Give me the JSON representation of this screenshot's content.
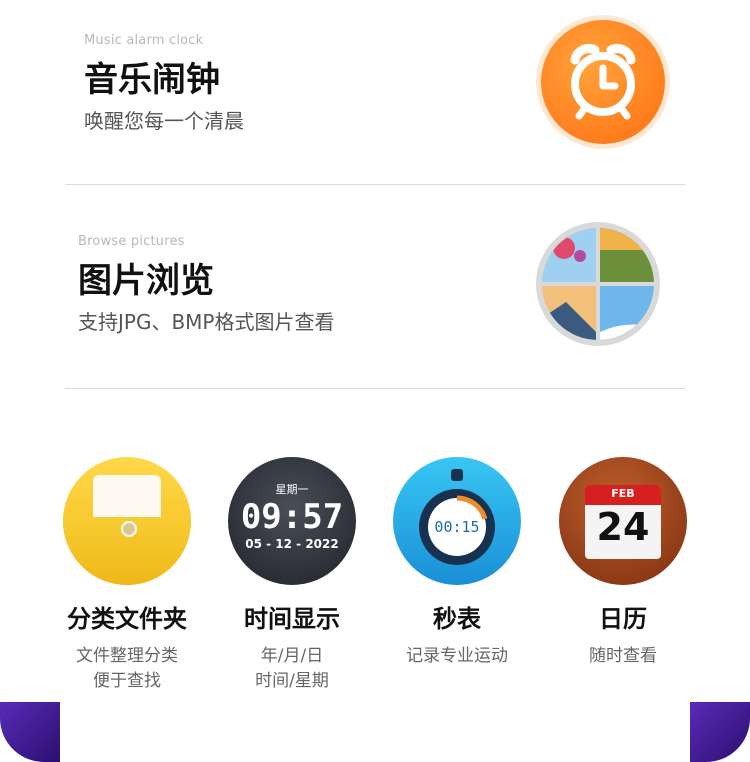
{
  "alarm": {
    "subtitle_en": "Music alarm clock",
    "title": "音乐闹钟",
    "desc": "唤醒您每一个清晨",
    "icon": "alarm-clock-icon",
    "color": "#ff7a1a"
  },
  "gallery": {
    "subtitle_en": "Browse pictures",
    "title": "图片浏览",
    "desc": "支持JPG、BMP格式图片查看",
    "icon": "photo-grid-icon"
  },
  "features": [
    {
      "name": "分类文件夹",
      "line1": "文件整理分类",
      "line2": "便于查找",
      "icon": "folder-icon",
      "color": "#f5c22a"
    },
    {
      "name": "时间显示",
      "line1": "年/月/日",
      "line2": "时间/星期",
      "icon": "watch-face-icon",
      "watch": {
        "weekday": "星期一",
        "time": "09:57",
        "date": "05 - 12 - 2022"
      }
    },
    {
      "name": "秒表",
      "line1": "记录专业运动",
      "line2": "",
      "icon": "stopwatch-icon",
      "stopwatch": "00:15",
      "color": "#1ea9e6"
    },
    {
      "name": "日历",
      "line1": "随时查看",
      "line2": "",
      "icon": "calendar-icon",
      "calendar": {
        "month": "FEB",
        "day": "24"
      },
      "color": "#9a3f1a"
    }
  ]
}
